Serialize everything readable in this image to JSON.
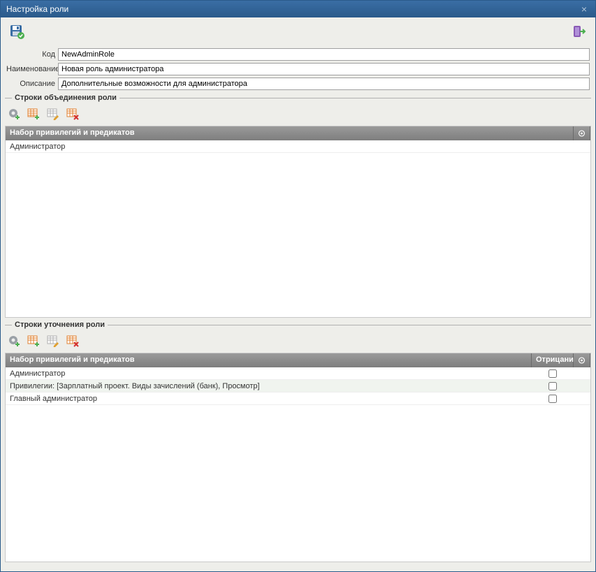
{
  "window": {
    "title": "Настройка роли"
  },
  "form": {
    "code_label": "Код",
    "code_value": "NewAdminRole",
    "name_label": "Наименование",
    "name_value": "Новая роль администратора",
    "desc_label": "Описание",
    "desc_value": "Дополнительные возможности для администратора"
  },
  "section_union": {
    "legend": "Строки объединения роли",
    "grid": {
      "header_name": "Набор привилегий и предикатов",
      "rows": [
        {
          "name": "Администратор"
        }
      ]
    }
  },
  "section_refine": {
    "legend": "Строки уточнения роли",
    "grid": {
      "header_name": "Набор привилегий и предикатов",
      "header_neg": "Отрицани",
      "rows": [
        {
          "name": "Администратор",
          "neg": false
        },
        {
          "name": "Привилегии: [Зарплатный проект. Виды зачислений (банк), Просмотр]",
          "neg": false
        },
        {
          "name": "Главный администратор",
          "neg": false
        }
      ]
    }
  }
}
